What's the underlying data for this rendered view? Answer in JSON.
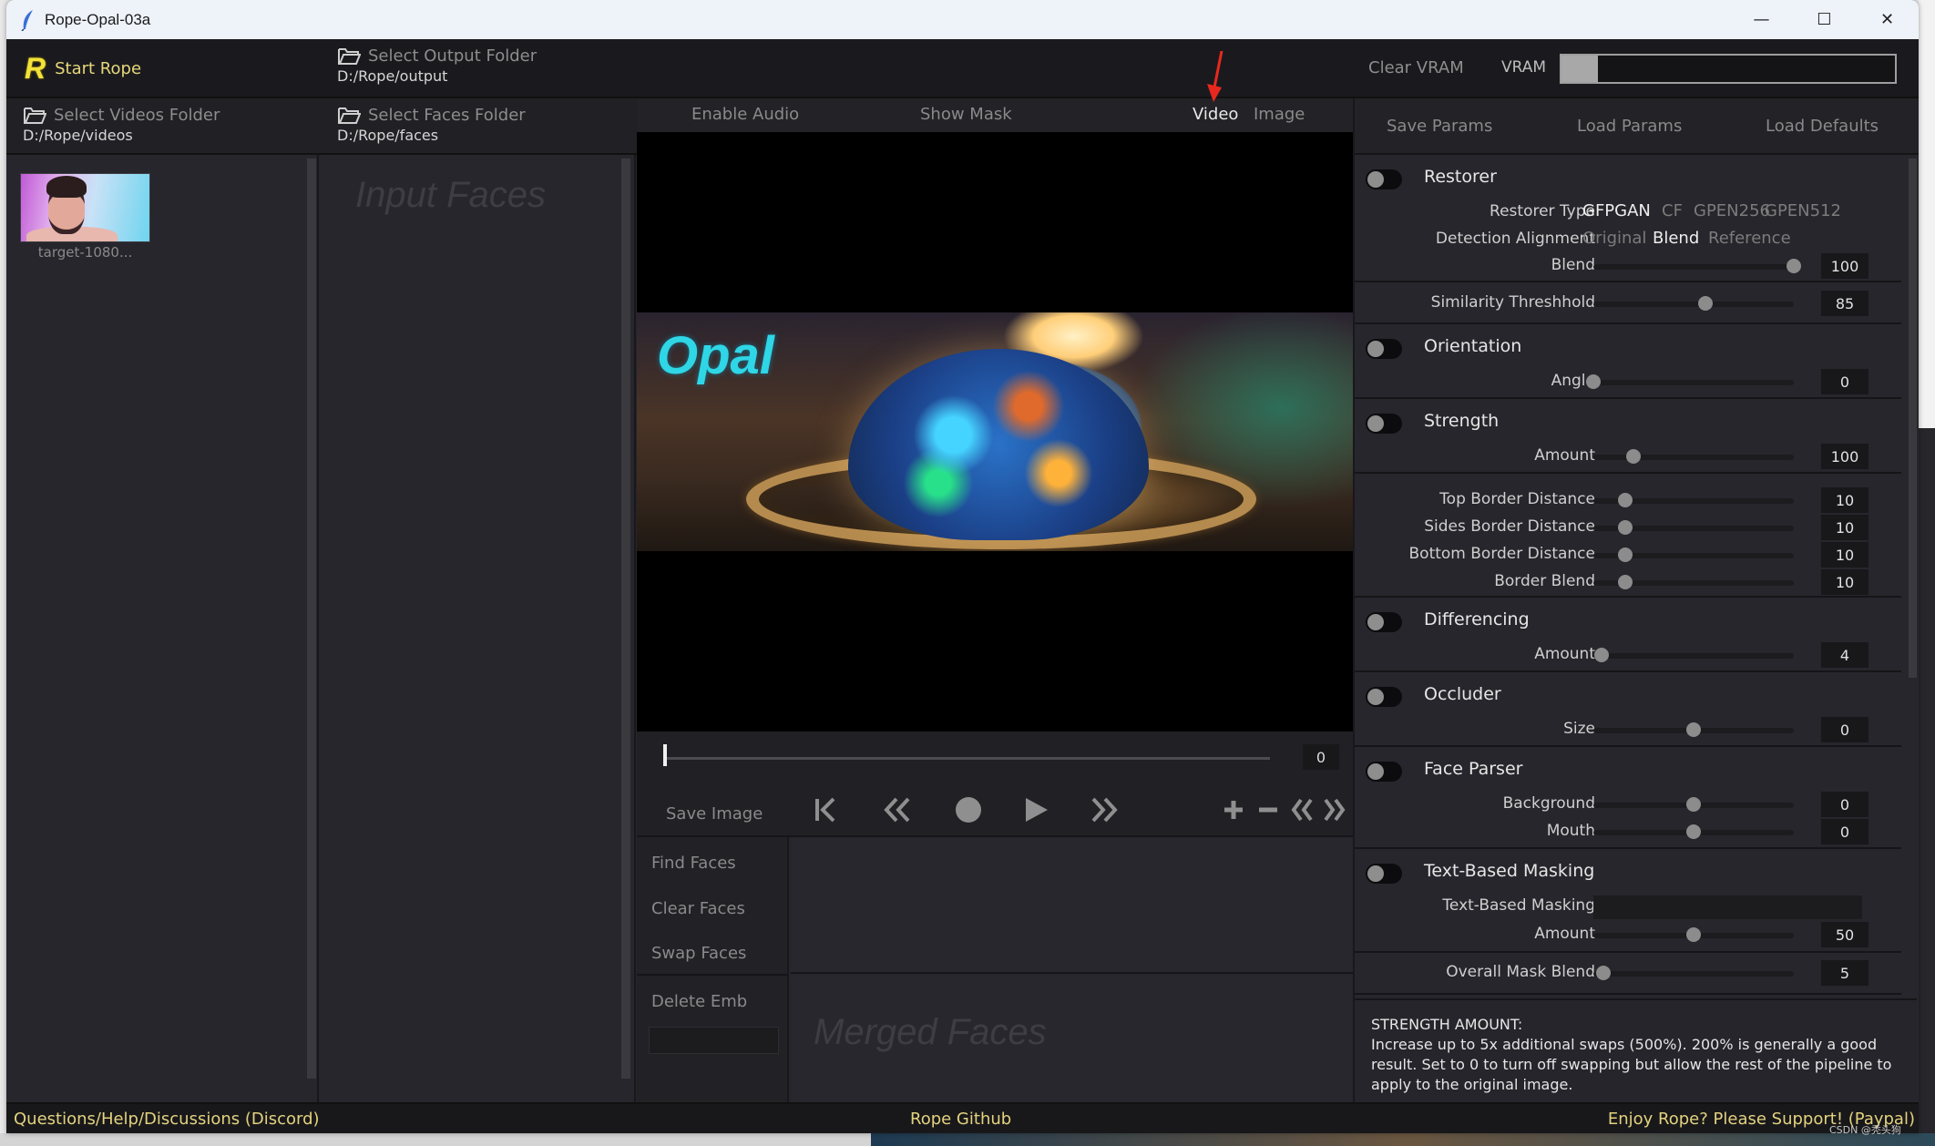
{
  "window": {
    "title": "Rope-Opal-03a"
  },
  "window_buttons": {
    "minimize": "—",
    "maximize": "☐",
    "close": "✕"
  },
  "top": {
    "start_rope": "Start Rope",
    "logo_letter": "R",
    "output_folder": {
      "label": "Select Output Folder",
      "path": "D:/Rope/output"
    },
    "videos_folder": {
      "label": "Select Videos Folder",
      "path": "D:/Rope/videos"
    },
    "faces_folder": {
      "label": "Select Faces Folder",
      "path": "D:/Rope/faces"
    },
    "clear_vram": "Clear VRAM",
    "vram_label": "VRAM",
    "vram_usage_fraction": 0.11
  },
  "videos": [
    {
      "caption": "target-1080..."
    }
  ],
  "input_faces_placeholder": "Input Faces",
  "center": {
    "enable_audio": "Enable Audio",
    "show_mask": "Show Mask",
    "mode_video": "Video",
    "mode_image": "Image",
    "active_mode": "Video",
    "preview_text": "Opal",
    "frame_number": "0",
    "seek_position_fraction": 0.0,
    "save_image": "Save Image",
    "controls": {
      "first_frame": "⟪",
      "rewind": "«",
      "record": "●",
      "play": "▶",
      "forward": "»",
      "zoom_in": "+",
      "zoom_out": "−",
      "prev_marker": "«",
      "next_marker": "»"
    },
    "find_faces": "Find Faces",
    "clear_faces": "Clear Faces",
    "swap_faces": "Swap Faces",
    "delete_emb": "Delete Emb",
    "merged_faces_placeholder": "Merged Faces"
  },
  "params": {
    "save_params": "Save Params",
    "load_params": "Load Params",
    "load_defaults": "Load Defaults",
    "restorer": {
      "title": "Restorer",
      "enabled": false,
      "type_label": "Restorer Type",
      "types": [
        "GFPGAN",
        "CF",
        "GPEN256",
        "GPEN512"
      ],
      "selected_type": "GFPGAN",
      "alignment_label": "Detection Alignment",
      "alignments": [
        "Original",
        "Blend",
        "Reference"
      ],
      "selected_alignment": "Blend",
      "blend_label": "Blend",
      "blend_value": "100",
      "blend_fraction": 1.0
    },
    "similarity": {
      "label": "Similarity Threshhold",
      "value": "85",
      "fraction": 0.56
    },
    "orientation": {
      "title": "Orientation",
      "enabled": false,
      "angle_label": "Angle",
      "angle_value": "0",
      "fraction": 0.0
    },
    "strength": {
      "title": "Strength",
      "enabled": false,
      "amount_label": "Amount",
      "amount_value": "100",
      "fraction": 0.2
    },
    "borders": {
      "top_label": "Top Border Distance",
      "top_value": "10",
      "sides_label": "Sides Border Distance",
      "sides_value": "10",
      "bottom_label": "Bottom Border Distance",
      "bottom_value": "10",
      "blend_label": "Border Blend",
      "blend_value": "10",
      "fraction": 0.16
    },
    "differencing": {
      "title": "Differencing",
      "enabled": false,
      "amount_label": "Amount",
      "amount_value": "4",
      "fraction": 0.04
    },
    "occluder": {
      "title": "Occluder",
      "enabled": false,
      "size_label": "Size",
      "size_value": "0",
      "fraction": 0.5
    },
    "face_parser": {
      "title": "Face Parser",
      "enabled": false,
      "background_label": "Background",
      "background_value": "0",
      "background_fraction": 0.5,
      "mouth_label": "Mouth",
      "mouth_value": "0",
      "mouth_fraction": 0.5
    },
    "text_masking": {
      "title": "Text-Based Masking",
      "enabled": false,
      "input_label": "Text-Based Masking",
      "input_value": "",
      "amount_label": "Amount",
      "amount_value": "50",
      "fraction": 0.5
    },
    "overall_mask_blend": {
      "label": "Overall Mask Blend",
      "value": "5",
      "fraction": 0.05
    },
    "help": {
      "title": "STRENGTH AMOUNT:",
      "body": "Increase up to 5x additional swaps (500%). 200% is generally a good result. Set to 0 to turn off swapping but allow the rest of the pipeline to apply to the original image."
    }
  },
  "status": {
    "discord": "Questions/Help/Discussions (Discord)",
    "github": "Rope Github",
    "paypal": "Enjoy Rope? Please Support! (Paypal)"
  },
  "watermark": "CSDN @秃头狗"
}
